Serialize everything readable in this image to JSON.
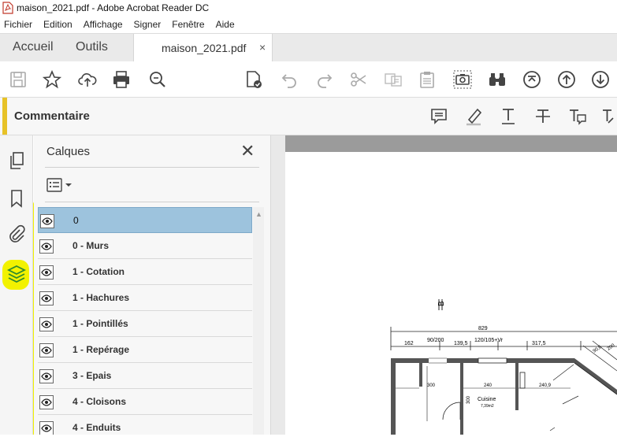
{
  "window": {
    "title": "maison_2021.pdf - Adobe Acrobat Reader DC"
  },
  "menu": [
    "Fichier",
    "Edition",
    "Affichage",
    "Signer",
    "Fenêtre",
    "Aide"
  ],
  "tabs": {
    "home": "Accueil",
    "tools": "Outils",
    "document": "maison_2021.pdf",
    "close": "×"
  },
  "commentbar": {
    "label": "Commentaire"
  },
  "panel": {
    "title": "Calques",
    "close": "✕",
    "layers": [
      "0",
      "0 - Murs",
      "1 - Cotation",
      "1 - Hachures",
      "1 - Pointillés",
      "1 - Repérage",
      "3 - Epais",
      "4 - Cloisons",
      "4 - Enduits"
    ],
    "selected_index": 0
  },
  "plan": {
    "top_dim": "829",
    "dims": [
      "162",
      "90/200",
      "139,5",
      "120/105+Vr",
      "317,5"
    ],
    "room_dims": [
      "300",
      "240",
      "240,9",
      "300"
    ],
    "room_name": "Cuisine",
    "room_area": "7,39m2",
    "right_dims": [
      "90,6",
      "200"
    ],
    "section_label": "B"
  },
  "colors": {
    "accent": "#e7c227",
    "highlight": "#f2f200",
    "selected_row": "#9dc3dd"
  }
}
